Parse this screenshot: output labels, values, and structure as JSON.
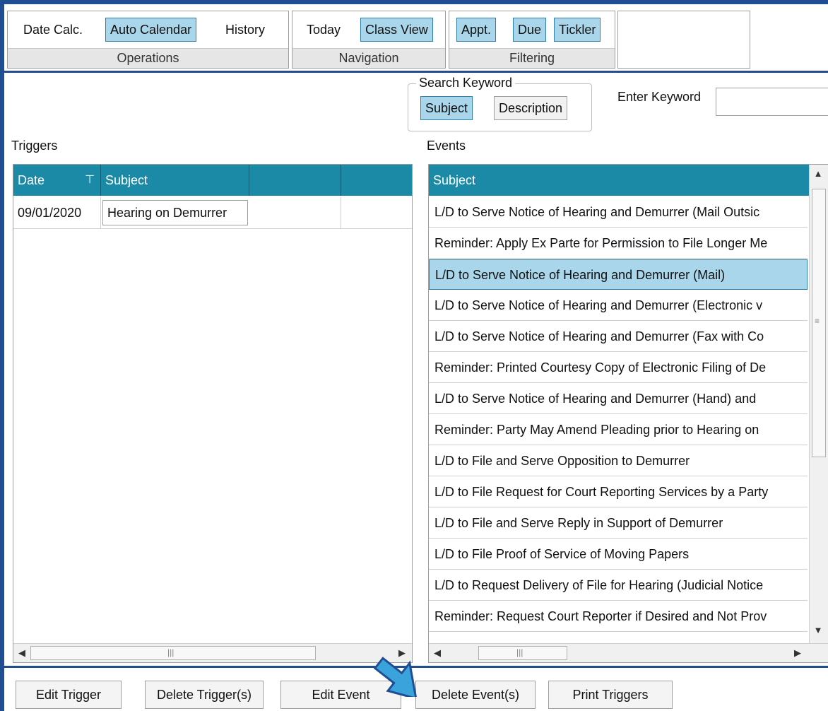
{
  "ribbon": {
    "operations": {
      "caption": "Operations",
      "buttons": [
        {
          "label": "Date Calc.",
          "active": false
        },
        {
          "label": "Auto Calendar",
          "active": true
        },
        {
          "label": "History",
          "active": false
        }
      ]
    },
    "navigation": {
      "caption": "Navigation",
      "buttons": [
        {
          "label": "Today",
          "active": false
        },
        {
          "label": "Class View",
          "active": true
        }
      ]
    },
    "filtering": {
      "caption": "Filtering",
      "buttons": [
        {
          "label": "Appt.",
          "active": true
        },
        {
          "label": "Due",
          "active": true
        },
        {
          "label": "Tickler",
          "active": true
        }
      ]
    }
  },
  "search": {
    "legend": "Search Keyword",
    "subject_label": "Subject",
    "description_label": "Description",
    "keyword_label": "Enter Keyword",
    "keyword_value": ""
  },
  "triggers": {
    "label": "Triggers",
    "columns": [
      "Date",
      "Subject",
      "",
      ""
    ],
    "rows": [
      {
        "date": "09/01/2020",
        "subject": "Hearing on Demurrer"
      }
    ]
  },
  "events": {
    "label": "Events",
    "column": "Subject",
    "selected_index": 2,
    "rows": [
      "L/D to Serve Notice of Hearing and Demurrer (Mail Outsic",
      "Reminder: Apply Ex Parte for Permission to File Longer Me",
      "L/D to Serve Notice of Hearing and Demurrer (Mail)",
      "L/D to Serve Notice of Hearing and Demurrer (Electronic v",
      "L/D to Serve Notice of Hearing and Demurrer (Fax with Co",
      "Reminder: Printed Courtesy Copy of Electronic Filing of De",
      "L/D to Serve Notice of Hearing and Demurrer (Hand) and",
      "Reminder: Party May Amend Pleading prior to Hearing on",
      "L/D to File and Serve Opposition to Demurrer",
      "L/D to File Request for Court Reporting Services by a Party",
      "L/D to File and Serve Reply in Support of Demurrer",
      "L/D to File Proof of Service of Moving Papers",
      "L/D to Request Delivery of File for Hearing (Judicial Notice",
      "Reminder: Request Court Reporter if Desired and Not Prov"
    ]
  },
  "actions": {
    "edit_trigger": "Edit Trigger",
    "delete_triggers": "Delete Trigger(s)",
    "edit_event": "Edit Event",
    "delete_events": "Delete Event(s)",
    "print_triggers": "Print Triggers"
  },
  "colors": {
    "header_teal": "#1a8aa6",
    "selection": "#a9d6ea",
    "frame_blue": "#1f4e93",
    "pointer_arrow": "#3aa3dc"
  }
}
